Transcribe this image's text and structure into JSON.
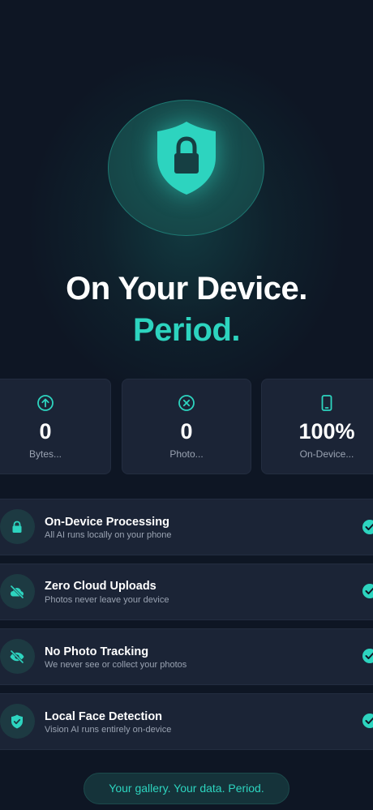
{
  "hero": {
    "icon": "shield-lock-icon",
    "title_line1": "On Your Device.",
    "title_line2": "Period.",
    "accent_color": "#2dd4bf"
  },
  "stats": [
    {
      "icon": "arrow-up-circle-icon",
      "value": "0",
      "label": "Bytes..."
    },
    {
      "icon": "x-circle-icon",
      "value": "0",
      "label": "Photo..."
    },
    {
      "icon": "smartphone-icon",
      "value": "100%",
      "label": "On-Device..."
    }
  ],
  "features": [
    {
      "icon": "lock-icon",
      "title": "On-Device Processing",
      "subtitle": "All AI runs locally on your phone",
      "checked": true
    },
    {
      "icon": "cloud-off-icon",
      "title": "Zero Cloud Uploads",
      "subtitle": "Photos never leave your device",
      "checked": true
    },
    {
      "icon": "eye-off-icon",
      "title": "No Photo Tracking",
      "subtitle": "We never see or collect your photos",
      "checked": true
    },
    {
      "icon": "shield-check-icon",
      "title": "Local Face Detection",
      "subtitle": "Vision AI runs entirely on-device",
      "checked": true
    }
  ],
  "footer": {
    "tagline": "Your gallery. Your data. Period."
  }
}
